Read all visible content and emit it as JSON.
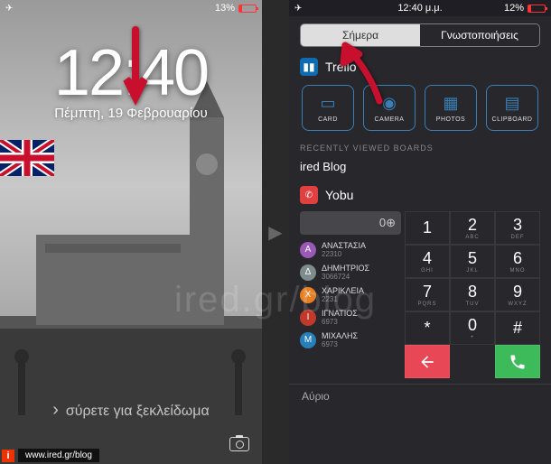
{
  "left": {
    "status": {
      "battery_pct": "13%",
      "time": ""
    },
    "time": "12:40",
    "date": "Πέμπτη, 19 Φεβρουαρίου",
    "unlock": "σύρετε για ξεκλείδωμα",
    "url": "www.ired.gr/blog",
    "info": "i"
  },
  "right": {
    "status": {
      "battery_pct": "12%",
      "time": "12:40 μ.μ."
    },
    "tabs": {
      "today": "Σήμερα",
      "notifications": "Γνωστοποιήσεις"
    },
    "trello": {
      "title": "Trello",
      "buttons": [
        {
          "label": "CARD"
        },
        {
          "label": "CAMERA"
        },
        {
          "label": "PHOTOS"
        },
        {
          "label": "CLIPBOARD"
        }
      ],
      "recent_label": "RECENTLY VIEWED BOARDS",
      "recent_board": "ired Blog"
    },
    "yobu": {
      "title": "Yobu",
      "display": "0⊕",
      "contacts": [
        {
          "initial": "Α",
          "name": "ΑΝΑΣΤΑΣΙΑ",
          "num": "22310",
          "color": "#9b59b6"
        },
        {
          "initial": "Δ",
          "name": "ΔΗΜΗΤΡΙΟΣ",
          "num": "3066724",
          "color": "#7f8c8d"
        },
        {
          "initial": "Χ",
          "name": "ΧΑΡΙΚΛΕΙΑ",
          "num": "2231",
          "color": "#e67e22"
        },
        {
          "initial": "Ι",
          "name": "ΙΓΝΑΤΙΟΣ",
          "num": "6973",
          "color": "#c0392b"
        },
        {
          "initial": "Μ",
          "name": "ΜΙΧΑΛΗΣ",
          "num": "6973",
          "color": "#2980b9"
        }
      ],
      "keys": [
        {
          "n": "1",
          "l": ""
        },
        {
          "n": "2",
          "l": "ABC"
        },
        {
          "n": "3",
          "l": "DEF"
        },
        {
          "n": "4",
          "l": "GHI"
        },
        {
          "n": "5",
          "l": "JKL"
        },
        {
          "n": "6",
          "l": "MNO"
        },
        {
          "n": "7",
          "l": "PQRS"
        },
        {
          "n": "8",
          "l": "TUV"
        },
        {
          "n": "9",
          "l": "WXYZ"
        },
        {
          "n": "*",
          "l": ""
        },
        {
          "n": "0",
          "l": "+"
        },
        {
          "n": "#",
          "l": ""
        }
      ]
    },
    "tomorrow": "Αύριο"
  },
  "watermark": "ired.gr/blog"
}
